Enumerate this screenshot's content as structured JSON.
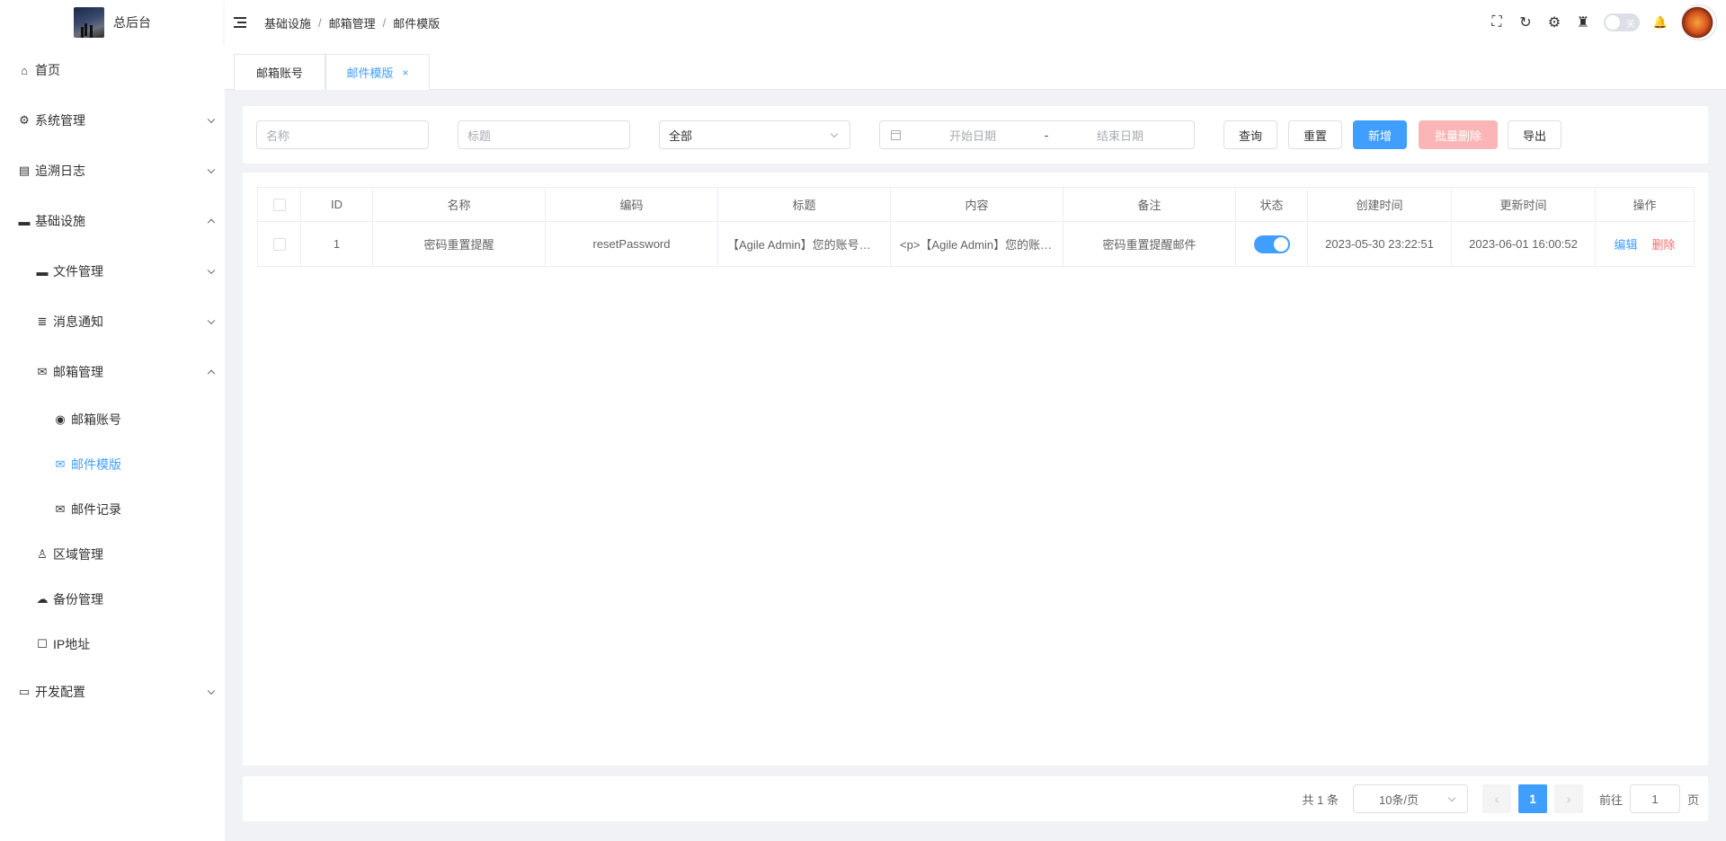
{
  "app": {
    "title": "总后台"
  },
  "sidebar": {
    "items": [
      {
        "label": "首页",
        "icon": "home-icon",
        "glyph": "⌂"
      },
      {
        "label": "系统管理",
        "icon": "gear-icon",
        "glyph": "⚙"
      },
      {
        "label": "追溯日志",
        "icon": "log-icon",
        "glyph": "▤"
      },
      {
        "label": "基础设施",
        "icon": "folder-icon",
        "glyph": "▬"
      },
      {
        "label": "文件管理",
        "icon": "folder-open-icon",
        "glyph": "▬"
      },
      {
        "label": "消息通知",
        "icon": "database-icon",
        "glyph": "≣"
      },
      {
        "label": "邮箱管理",
        "icon": "mail-icon",
        "glyph": "✉"
      },
      {
        "label": "邮箱账号",
        "icon": "account-icon",
        "glyph": "◉"
      },
      {
        "label": "邮件模版",
        "icon": "mail-template-icon",
        "glyph": "✉"
      },
      {
        "label": "邮件记录",
        "icon": "mail-record-icon",
        "glyph": "✉"
      },
      {
        "label": "区域管理",
        "icon": "user-icon",
        "glyph": "♙"
      },
      {
        "label": "备份管理",
        "icon": "cloud-icon",
        "glyph": "☁"
      },
      {
        "label": "IP地址",
        "icon": "square-icon",
        "glyph": "☐"
      },
      {
        "label": "开发配置",
        "icon": "monitor-icon",
        "glyph": "▭"
      }
    ]
  },
  "header": {
    "breadcrumb": [
      "基础设施",
      "邮箱管理",
      "邮件模版"
    ],
    "breadcrumb_sep": "/",
    "theme_switch_label": "关",
    "icons": {
      "fullscreen": "⛶",
      "refresh": "↻",
      "settings": "⚙",
      "clean": "♜",
      "bell": "🔔"
    }
  },
  "tabs": [
    {
      "label": "邮箱账号"
    },
    {
      "label": "邮件模版",
      "close": "×"
    }
  ],
  "search": {
    "name_placeholder": "名称",
    "title_placeholder": "标题",
    "status_value": "全部",
    "start_date_placeholder": "开始日期",
    "date_sep": "-",
    "end_date_placeholder": "结束日期",
    "query_label": "查询",
    "reset_label": "重置",
    "add_label": "新增",
    "batch_delete_label": "批量删除",
    "export_label": "导出"
  },
  "table": {
    "columns": [
      "ID",
      "名称",
      "编码",
      "标题",
      "内容",
      "备注",
      "状态",
      "创建时间",
      "更新时间",
      "操作"
    ],
    "rows": [
      {
        "id": "1",
        "name": "密码重置提醒",
        "code": "resetPassword",
        "title": "【Agile Admin】您的账号密码已重置",
        "content": "<p>【Agile Admin】您的账号密码已重置",
        "remark": "密码重置提醒邮件",
        "status": true,
        "created": "2023-05-30 23:22:51",
        "updated": "2023-06-01 16:00:52",
        "edit_label": "编辑",
        "delete_label": "删除"
      }
    ]
  },
  "pagination": {
    "total_text": "共 1 条",
    "page_size": "10条/页",
    "prev": "‹",
    "current": "1",
    "next": "›",
    "goto_label": "前往",
    "goto_value": "1",
    "page_unit": "页"
  },
  "colors": {
    "primary": "#409eff",
    "danger": "#f56c6c",
    "danger_light": "#fab6b6"
  }
}
